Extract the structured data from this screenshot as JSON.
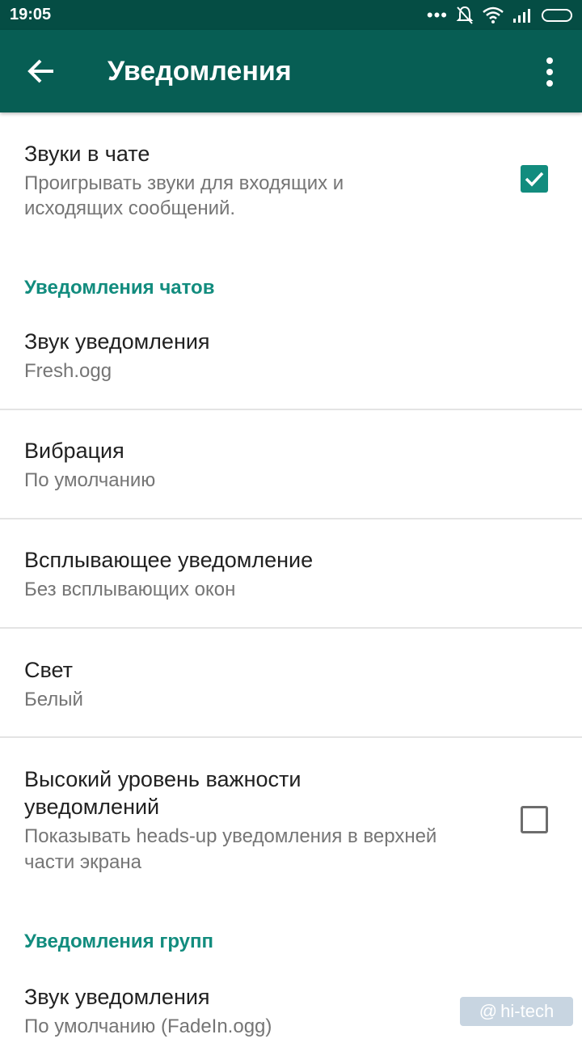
{
  "status_bar": {
    "time": "19:05"
  },
  "app_bar": {
    "title": "Уведомления"
  },
  "chat_sounds": {
    "title": "Звуки в чате",
    "summary_line1": "Проигрывать звуки для входящих и",
    "summary_line2": "исходящих сообщений.",
    "checked": true
  },
  "section_chats": "Уведомления чатов",
  "chat_items": [
    {
      "title": "Звук уведомления",
      "summary": "Fresh.ogg"
    },
    {
      "title": "Вибрация",
      "summary": "По умолчанию"
    },
    {
      "title": "Всплывающее уведомление",
      "summary": "Без всплывающих окон"
    },
    {
      "title": "Свет",
      "summary": "Белый"
    }
  ],
  "high_priority": {
    "title_line1": "Высокий уровень важности",
    "title_line2": "уведомлений",
    "summary_line1": "Показывать heads-up уведомления в верхней",
    "summary_line2": "части экрана",
    "checked": false
  },
  "section_groups": "Уведомления групп",
  "group_items": [
    {
      "title": "Звук уведомления",
      "summary": "По умолчанию (FadeIn.ogg)"
    }
  ],
  "watermark": {
    "at": "@",
    "text": "hi-tech"
  },
  "colors": {
    "status_bar": "#054d44",
    "app_bar": "#075e54",
    "accent": "#128c7e"
  }
}
